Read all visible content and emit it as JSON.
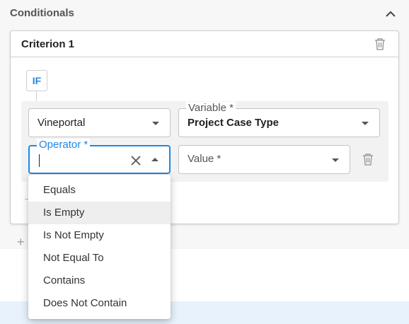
{
  "section": {
    "title": "Conditionals",
    "collapse_icon": "chevron-up-icon"
  },
  "criterion": {
    "title": "Criterion 1",
    "if_label": "IF",
    "source_field": {
      "value": "Vineportal"
    },
    "variable_field": {
      "label": "Variable *",
      "value": "Project Case Type"
    },
    "operator_field": {
      "label": "Operator *",
      "value": ""
    },
    "value_field": {
      "placeholder": "Value *"
    }
  },
  "operator_options": [
    {
      "label": "Equals"
    },
    {
      "label": "Is Empty"
    },
    {
      "label": "Is Not Empty"
    },
    {
      "label": "Not Equal To"
    },
    {
      "label": "Contains"
    },
    {
      "label": "Does Not Contain"
    }
  ],
  "highlighted_option": "Is Empty",
  "colors": {
    "accent": "#1e88e5",
    "highlight_row": "#eeeeee",
    "bottom_band": "#e7f2fc"
  }
}
